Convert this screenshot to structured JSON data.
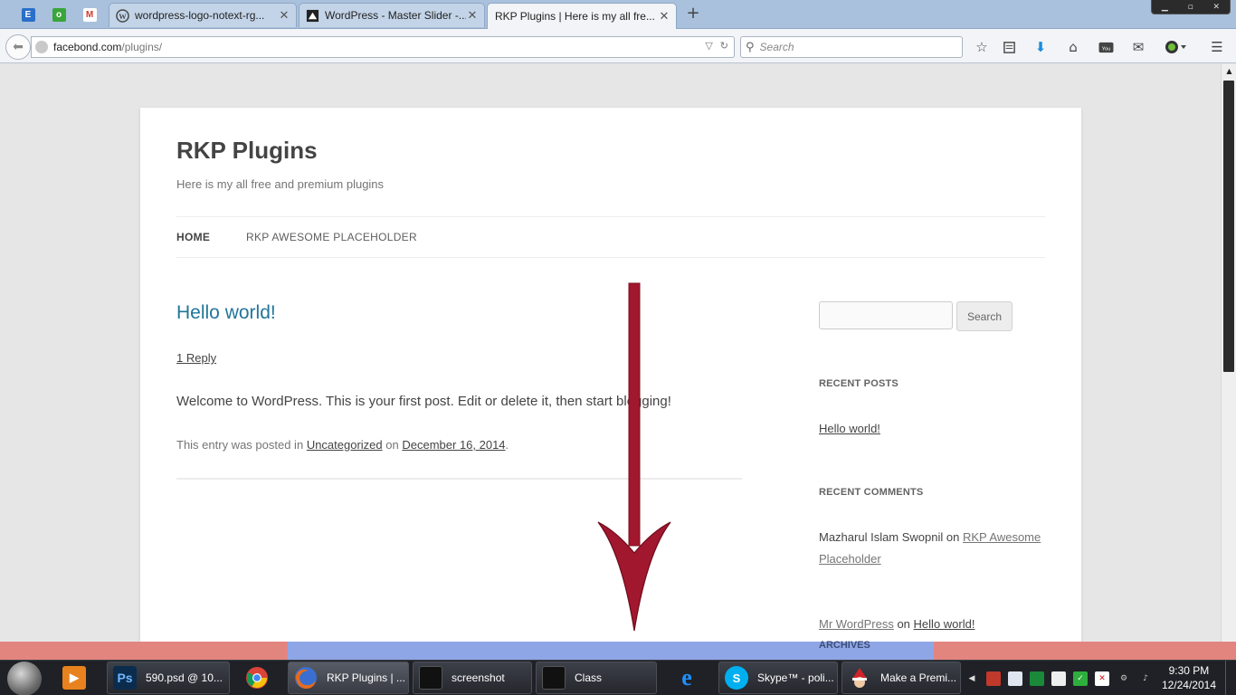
{
  "browser": {
    "pinned_tabs": [
      {
        "icon": "evernote-icon",
        "glyph": "E",
        "color": "#2a6fc9"
      },
      {
        "icon": "odnoklassniki-icon",
        "glyph": "o",
        "color": "#3aa53a"
      },
      {
        "icon": "gmail-icon",
        "glyph": "M",
        "color": "#d33b2c"
      }
    ],
    "tabs": [
      {
        "title": "wordpress-logo-notext-rg...",
        "icon": "wordpress-icon"
      },
      {
        "title": "WordPress - Master Slider -...",
        "icon": "master-slider-icon"
      },
      {
        "title": "RKP Plugins | Here is my all fre...",
        "icon": "none",
        "active": true
      }
    ],
    "url_host": "facebond.com",
    "url_path": "/plugins/",
    "search_placeholder": "Search"
  },
  "site": {
    "title": "RKP Plugins",
    "description": "Here is my all free and premium plugins",
    "menu": [
      {
        "label": "HOME",
        "current": true
      },
      {
        "label": "RKP AWESOME PLACEHOLDER",
        "current": false
      }
    ]
  },
  "post": {
    "title": "Hello world!",
    "reply_link": "1 Reply",
    "content": "Welcome to WordPress. This is your first post. Edit or delete it, then start blogging!",
    "meta_prefix": "This entry was posted in",
    "category": "Uncategorized",
    "meta_on": "on",
    "date": "December 16, 2014",
    "meta_end": "."
  },
  "sidebar": {
    "search_button": "Search",
    "recent_posts_title": "RECENT POSTS",
    "recent_posts": [
      "Hello world!"
    ],
    "recent_comments_title": "RECENT COMMENTS",
    "comment1_author": "Mazharul Islam Swopnil",
    "comment1_on": "on",
    "comment1_post": "RKP Awesome Placeholder",
    "comment2_author": "Mr WordPress",
    "comment2_on": "on",
    "comment2_post": "Hello world!",
    "archives_title": "ARCHIVES"
  },
  "overlay": {
    "arrow_color": "#a1172e"
  },
  "taskbar": {
    "buttons": [
      {
        "label": "",
        "icon": "media-player-icon"
      },
      {
        "label": "590.psd @ 10...",
        "icon": "photoshop-icon"
      },
      {
        "label": "",
        "icon": "chrome-icon"
      },
      {
        "label": "RKP Plugins | ...",
        "icon": "firefox-icon"
      },
      {
        "label": "screenshot",
        "icon": "folder-icon"
      },
      {
        "label": "Class",
        "icon": "folder-icon"
      },
      {
        "label": "",
        "icon": "internet-explorer-icon"
      },
      {
        "label": "Skype™ - poli...",
        "icon": "skype-icon"
      },
      {
        "label": "Make a Premi...",
        "icon": "santa-icon"
      }
    ],
    "time": "9:30 PM",
    "date": "12/24/2014"
  }
}
